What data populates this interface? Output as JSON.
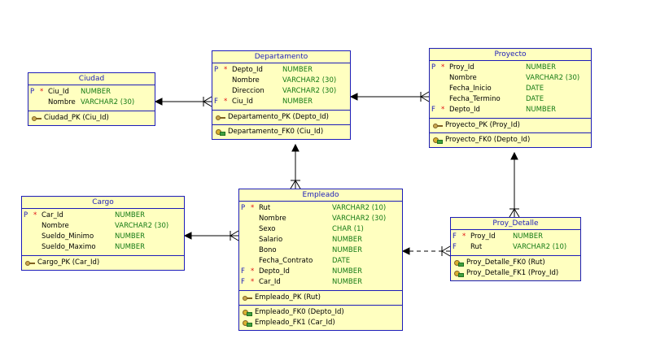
{
  "entities": {
    "ciudad": {
      "title": "Ciudad",
      "columns": [
        {
          "p": "P",
          "r": "*",
          "name": "Ciu_Id",
          "type": "NUMBER"
        },
        {
          "p": "",
          "r": "",
          "name": "Nombre",
          "type": "VARCHAR2 (30)"
        }
      ],
      "pks": [
        "Ciudad_PK (Ciu_Id)"
      ],
      "fks": []
    },
    "departamento": {
      "title": "Departamento",
      "columns": [
        {
          "p": "P",
          "r": "*",
          "name": "Depto_Id",
          "type": "NUMBER"
        },
        {
          "p": "",
          "r": "",
          "name": "Nombre",
          "type": "VARCHAR2 (30)"
        },
        {
          "p": "",
          "r": "",
          "name": "Direccion",
          "type": "VARCHAR2 (30)"
        },
        {
          "p": "F",
          "r": "*",
          "name": "Ciu_Id",
          "type": "NUMBER"
        }
      ],
      "pks": [
        "Departamento_PK (Depto_Id)"
      ],
      "fks": [
        "Departamento_FK0 (Ciu_Id)"
      ]
    },
    "proyecto": {
      "title": "Proyecto",
      "columns": [
        {
          "p": "P",
          "r": "*",
          "name": "Proy_Id",
          "type": "NUMBER"
        },
        {
          "p": "",
          "r": "",
          "name": "Nombre",
          "type": "VARCHAR2 (30)"
        },
        {
          "p": "",
          "r": "",
          "name": "Fecha_Inicio",
          "type": "DATE"
        },
        {
          "p": "",
          "r": "",
          "name": "Fecha_Termino",
          "type": "DATE"
        },
        {
          "p": "F",
          "r": "*",
          "name": "Depto_Id",
          "type": "NUMBER"
        }
      ],
      "pks": [
        "Proyecto_PK (Proy_Id)"
      ],
      "fks": [
        "Proyecto_FK0 (Depto_Id)"
      ]
    },
    "cargo": {
      "title": "Cargo",
      "columns": [
        {
          "p": "P",
          "r": "*",
          "name": "Car_Id",
          "type": "NUMBER"
        },
        {
          "p": "",
          "r": "",
          "name": "Nombre",
          "type": "VARCHAR2 (30)"
        },
        {
          "p": "",
          "r": "",
          "name": "Sueldo_Minimo",
          "type": "NUMBER"
        },
        {
          "p": "",
          "r": "",
          "name": "Sueldo_Maximo",
          "type": "NUMBER"
        }
      ],
      "pks": [
        "Cargo_PK (Car_Id)"
      ],
      "fks": []
    },
    "empleado": {
      "title": "Empleado",
      "columns": [
        {
          "p": "P",
          "r": "*",
          "name": "Rut",
          "type": "VARCHAR2 (10)"
        },
        {
          "p": "",
          "r": "",
          "name": "Nombre",
          "type": "VARCHAR2 (30)"
        },
        {
          "p": "",
          "r": "",
          "name": "Sexo",
          "type": "CHAR (1)"
        },
        {
          "p": "",
          "r": "",
          "name": "Salario",
          "type": "NUMBER"
        },
        {
          "p": "",
          "r": "",
          "name": "Bono",
          "type": "NUMBER"
        },
        {
          "p": "",
          "r": "",
          "name": "Fecha_Contrato",
          "type": "DATE"
        },
        {
          "p": "F",
          "r": "*",
          "name": "Depto_Id",
          "type": "NUMBER"
        },
        {
          "p": "F",
          "r": "*",
          "name": "Car_Id",
          "type": "NUMBER"
        }
      ],
      "pks": [
        "Empleado_PK (Rut)"
      ],
      "fks": [
        "Empleado_FK0 (Depto_Id)",
        "Empleado_FK1 (Car_Id)"
      ]
    },
    "proy_detalle": {
      "title": "Proy_Detalle",
      "columns": [
        {
          "p": "F",
          "r": "*",
          "name": "Proy_Id",
          "type": "NUMBER"
        },
        {
          "p": "F",
          "r": "",
          "name": "Rut",
          "type": "VARCHAR2 (10)"
        }
      ],
      "pks": [],
      "fks": [
        "Proy_Detalle_FK0 (Rut)",
        "Proy_Detalle_FK1 (Proy_Id)"
      ]
    }
  },
  "relationships": [
    {
      "from": "departamento",
      "to": "ciudad",
      "style": "solid"
    },
    {
      "from": "proyecto",
      "to": "departamento",
      "style": "solid"
    },
    {
      "from": "empleado",
      "to": "departamento",
      "style": "solid"
    },
    {
      "from": "empleado",
      "to": "cargo",
      "style": "solid"
    },
    {
      "from": "proy_detalle",
      "to": "proyecto",
      "style": "solid"
    },
    {
      "from": "proy_detalle",
      "to": "empleado",
      "style": "dashed"
    }
  ],
  "colors": {
    "entity_fill": "#ffffc0",
    "border": "#1c1cb8",
    "type_text": "#147a14",
    "required_marker": "#e01010",
    "line": "#000000"
  }
}
